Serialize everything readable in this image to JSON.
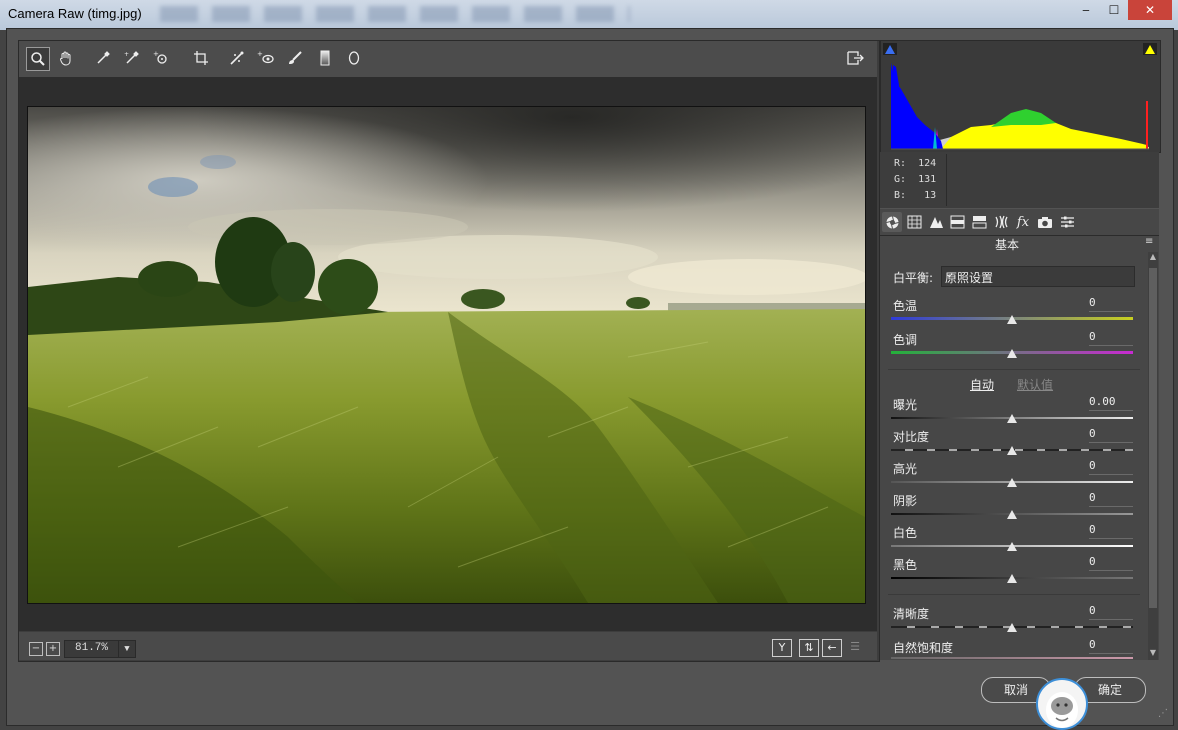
{
  "window": {
    "title": "Camera Raw (timg.jpg)",
    "controls": [
      "minimize-icon",
      "maximize-icon",
      "close-icon"
    ]
  },
  "toolbar": {
    "tools": [
      {
        "name": "zoom-tool-icon",
        "glyph": "⌕",
        "active": true
      },
      {
        "name": "hand-tool-icon",
        "glyph": "✋"
      },
      {
        "name": "white-balance-tool-icon",
        "glyph": "⟋"
      },
      {
        "name": "color-sampler-tool-icon",
        "glyph": "⟋"
      },
      {
        "name": "targeted-adjustment-tool-icon",
        "glyph": "⊙"
      },
      {
        "name": "crop-tool-icon",
        "glyph": "⌗"
      },
      {
        "name": "straighten-tool-icon",
        "glyph": "⟋"
      },
      {
        "name": "spot-removal-tool-icon",
        "glyph": "⊙"
      },
      {
        "name": "red-eye-tool-icon",
        "glyph": "◉"
      },
      {
        "name": "adjustment-brush-icon",
        "glyph": "✎"
      },
      {
        "name": "graduated-filter-icon",
        "glyph": "▥"
      },
      {
        "name": "radial-filter-icon",
        "glyph": "◯"
      }
    ],
    "export_icon": "export-icon"
  },
  "preview": {
    "zoom": "81.7%",
    "zoom_out": "−",
    "zoom_in": "+"
  },
  "readout": {
    "r": "R:  124",
    "g": "G:  131",
    "b": "B:   13"
  },
  "panel": {
    "title": "基本",
    "tabs": [
      "basic-icon",
      "tone-curve-icon",
      "detail-icon",
      "hsl-icon",
      "split-toning-icon",
      "lens-icon",
      "effects-icon",
      "camera-calibration-icon",
      "presets-icon"
    ],
    "white_balance": {
      "label": "白平衡:",
      "value": "原照设置"
    },
    "temperature": {
      "label": "色温",
      "value": "0",
      "level": 0.5
    },
    "tint": {
      "label": "色调",
      "value": "0",
      "level": 0.5
    },
    "auto": "自动",
    "default": "默认值",
    "exposure": {
      "label": "曝光",
      "value": "0.00",
      "level": 0.5
    },
    "contrast": {
      "label": "对比度",
      "value": "0",
      "level": 0.5
    },
    "highlights": {
      "label": "高光",
      "value": "0",
      "level": 0.5
    },
    "shadows": {
      "label": "阴影",
      "value": "0",
      "level": 0.5
    },
    "whites": {
      "label": "白色",
      "value": "0",
      "level": 0.5
    },
    "blacks": {
      "label": "黑色",
      "value": "0",
      "level": 0.5
    },
    "clarity": {
      "label": "清晰度",
      "value": "0",
      "level": 0.5
    },
    "vibrance": {
      "label": "自然饱和度",
      "value": "0",
      "level": 0.5
    }
  },
  "buttons": {
    "cancel": "取消",
    "ok": "确定"
  },
  "colors": {
    "accent": "#3d8fd8",
    "panel_bg": "#474747",
    "histogram_blue": "#0000ff",
    "histogram_yellow": "#ffff00",
    "histogram_green": "#32cd32"
  }
}
